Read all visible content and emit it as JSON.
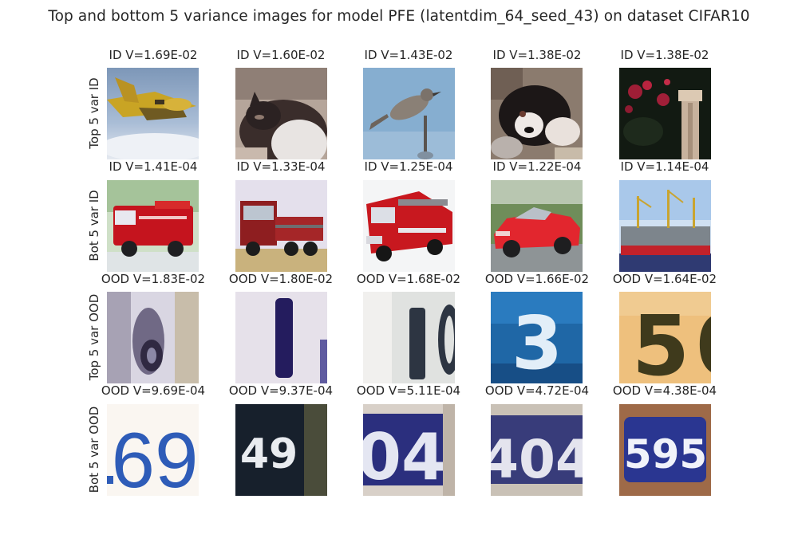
{
  "figure": {
    "title": "Top and bottom 5 variance images for model PFE (latentdim_64_seed_43) on dataset CIFAR10"
  },
  "rows": [
    {
      "label": "Top 5 var ID",
      "cells": [
        {
          "title": "ID V=1.69E-02",
          "content": "airplane"
        },
        {
          "title": "ID V=1.60E-02",
          "content": "cat"
        },
        {
          "title": "ID V=1.43E-02",
          "content": "bird"
        },
        {
          "title": "ID V=1.38E-02",
          "content": "dog"
        },
        {
          "title": "ID V=1.38E-02",
          "content": "flowers and post"
        }
      ]
    },
    {
      "label": "Bot 5 var ID",
      "cells": [
        {
          "title": "ID V=1.41E-04",
          "content": "red fire truck"
        },
        {
          "title": "ID V=1.33E-04",
          "content": "red truck"
        },
        {
          "title": "ID V=1.25E-04",
          "content": "fire engine"
        },
        {
          "title": "ID V=1.22E-04",
          "content": "red car"
        },
        {
          "title": "ID V=1.14E-04",
          "content": "ship"
        }
      ]
    },
    {
      "label": "Top 5 var OOD",
      "cells": [
        {
          "title": "OOD V=1.83E-02",
          "content": "blurry digit"
        },
        {
          "title": "OOD V=1.80E-02",
          "content": "digit"
        },
        {
          "title": "OOD V=1.68E-02",
          "content": "digits"
        },
        {
          "title": "OOD V=1.66E-02",
          "content": "digit"
        },
        {
          "title": "OOD V=1.64E-02",
          "content": "digits"
        }
      ]
    },
    {
      "label": "Bot 5 var OOD",
      "cells": [
        {
          "title": "OOD V=9.69E-04",
          "content": "house number"
        },
        {
          "title": "OOD V=9.37E-04",
          "content": "house number"
        },
        {
          "title": "OOD V=5.11E-04",
          "content": "house number"
        },
        {
          "title": "OOD V=4.72E-04",
          "content": "house number"
        },
        {
          "title": "OOD V=4.38E-04",
          "content": "house number"
        }
      ]
    }
  ]
}
